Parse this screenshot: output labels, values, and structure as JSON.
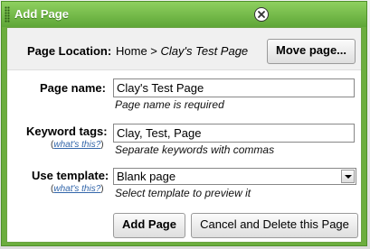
{
  "dialog": {
    "title": "Add Page"
  },
  "location": {
    "label": "Page Location:",
    "path_prefix": "Home > ",
    "path_page": "Clay's Test Page",
    "move_button": "Move page..."
  },
  "fields": {
    "page_name": {
      "label": "Page name:",
      "value": "Clay's Test Page",
      "hint": "Page name is required"
    },
    "keywords": {
      "label": "Keyword tags:",
      "help_open": "(",
      "help_link": "what's this?",
      "help_close": ")",
      "value": "Clay, Test, Page",
      "hint": "Separate keywords with commas"
    },
    "template": {
      "label": "Use template:",
      "help_open": "(",
      "help_link": "what's this?",
      "help_close": ")",
      "selected": "Blank page",
      "hint": "Select template to preview it"
    }
  },
  "actions": {
    "add_page": "Add Page",
    "cancel_delete": "Cancel and Delete this Page"
  },
  "colors": {
    "titlebar": "#6cae3e",
    "link": "#3366aa"
  },
  "icons": {
    "close": "close-icon",
    "grip": "grip-handle-icon",
    "dropdown": "chevron-down-icon"
  }
}
